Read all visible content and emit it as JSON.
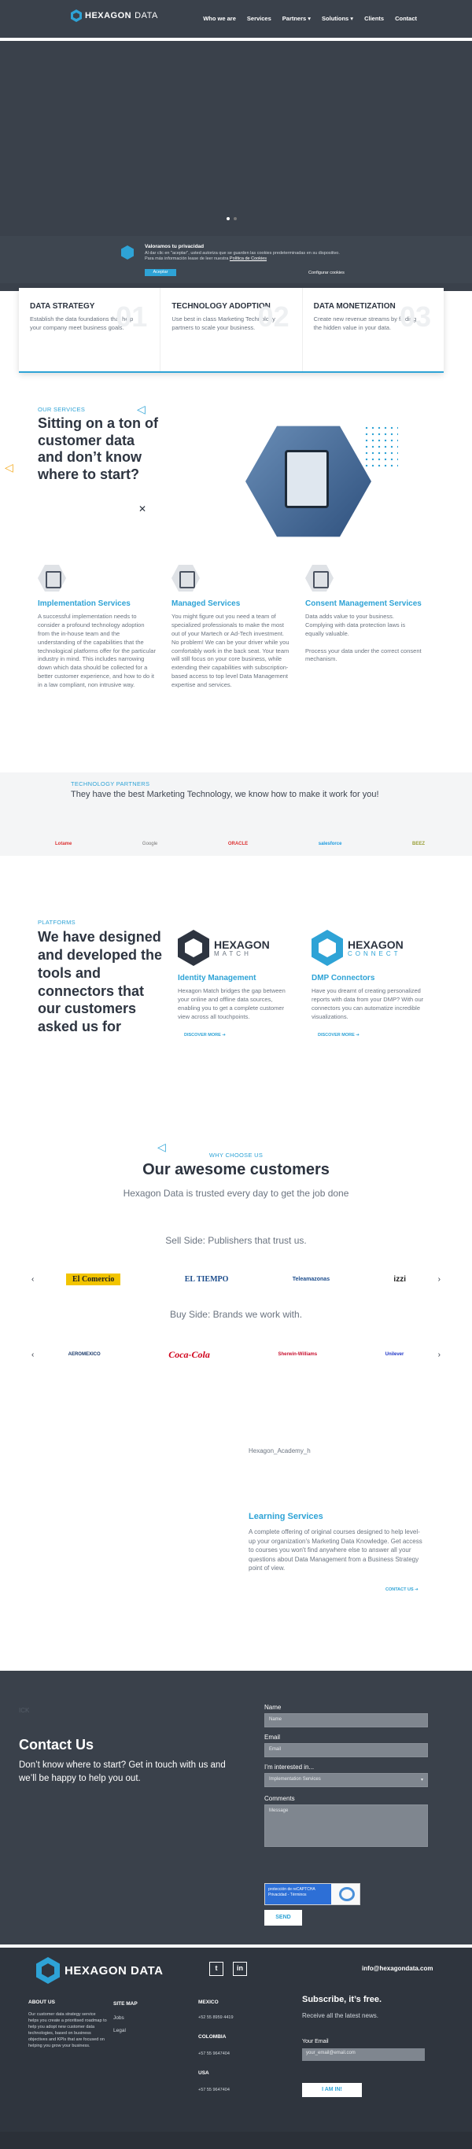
{
  "header": {
    "logo_text": "HEXAGON",
    "logo_text_2": "DATA",
    "nav": [
      "Who we are",
      "Services",
      "Partners ▾",
      "Solutions ▾",
      "Clients",
      "Contact"
    ]
  },
  "cookie": {
    "title": "Valoramos tu privacidad",
    "text": "Al dar clic en \"aceptar\", usted autoriza que se guarden las cookies predeterminadas en su dispositivo. Para más información lease de leer nuestra",
    "link": "Política de Cookies",
    "accept": "Aceptar",
    "config": "Configurar cookies"
  },
  "cards": [
    {
      "title": "DATA STRATEGY",
      "text": "Establish the data foundations that help your company meet business goals.",
      "num": "01"
    },
    {
      "title": "TECHNOLOGY ADOPTION",
      "text": "Use best in class Marketing Technology partners to scale your business.",
      "num": "02"
    },
    {
      "title": "DATA MONETIZATION",
      "text": "Create new revenue streams by finding the hidden value in your data.",
      "num": "03"
    }
  ],
  "services": {
    "eyebrow": "OUR SERVICES",
    "title": "Sitting on a ton of customer data and don’t know where to start?",
    "items": [
      {
        "title": "Implementation Services",
        "text": "A successful implementation needs to consider a profound technology adoption from the in-house team and the understanding of the capabilities that the technological platforms offer for the particular industry in mind. This includes narrowing down which data should be collected for a better customer experience, and how to do it in a law compliant, non intrusive way."
      },
      {
        "title": "Managed Services",
        "text": "You might figure out you need a team of specialized professionals to make the most out of your Martech or Ad-Tech investment. No problem!  We can be your driver while you comfortably work in the back seat. Your team will still focus on your core business, while extending their capabilities with subscription-based access to top level Data Management expertise and services."
      },
      {
        "title": "Consent Management Services",
        "text": "Data adds value to your business. Complying with data protection laws is equally valuable.\n\nProcess your data under the correct consent mechanism."
      }
    ]
  },
  "partners": {
    "eyebrow": "TECHNOLOGY PARTNERS",
    "title": "They have the best Marketing Technology, we know how to make it work for you!",
    "logos": [
      "Lotame",
      "Google",
      "ORACLE",
      "salesforce",
      "BEEZ"
    ]
  },
  "platforms": {
    "eyebrow": "PLATFORMS",
    "title": "We have designed and developed the tools and connectors that our customers asked us for",
    "items": [
      {
        "name": "HEXAGON",
        "sub": "MATCH",
        "title": "Identity Management",
        "text": "Hexagon Match bridges the gap between your online and offline data sources, enabling you to get a complete customer view across all touchpoints.",
        "more": "DISCOVER MORE  ➔"
      },
      {
        "name": "HEXAGON",
        "sub": "CONNECT",
        "title": "DMP Connectors",
        "text": "Have you dreamt of creating personalized reports with data from your DMP? With our connectors you can automatize incredible visualizations.",
        "more": "DISCOVER MORE  ➔"
      }
    ]
  },
  "why": {
    "eyebrow": "WHY CHOOSE US",
    "title": "Our awesome customers",
    "subtitle": "Hexagon Data is trusted every day to get the job done",
    "sell_title": "Sell Side: Publishers that trust us.",
    "sell_logos": [
      "El Comercio",
      "EL TIEMPO",
      "Teleamazonas",
      "izzi"
    ],
    "buy_title": "Buy Side: Brands we work with.",
    "buy_logos": [
      "AEROMEXICO",
      "Coca-Cola",
      "Sherwin-Williams",
      "Unilever"
    ]
  },
  "academy": {
    "img_alt": "Hexagon_Academy_h",
    "title": "Learning Services",
    "text": "A complete offering of original courses designed to help level-up your organization's Marketing Data Knowledge. Get access to courses you won't find anywhere else to answer all your questions about Data Management from a Business Strategy point of view.",
    "more": "CONTACT US  ➔"
  },
  "contact": {
    "ghost": "ICK",
    "title": "Contact Us",
    "subtitle": "Don’t know where to start? Get in touch with us and we’ll be happy to help you out.",
    "name_label": "Name",
    "name_placeholder": "Name",
    "email_label": "Email",
    "email_placeholder": "Email",
    "interest_label": "I’m interested in...",
    "interest_value": "Implementation Services",
    "comments_label": "Comments",
    "comments_placeholder": "Message",
    "captcha_text": "protección de reCAPTCHA\nPrivacidad - Términos",
    "send": "SEND"
  },
  "footer": {
    "logo_text": "HEXAGON DATA",
    "email": "info@hexagondata.com",
    "about_title": "ABOUT US",
    "about_text": "Our customer data strategy service helps you create a prioritised roadmap to help you adopt new customer data technologies, based on business objectives and KPIs that are focused on helping you grow your business.",
    "sitemap_title": "SITE MAP",
    "sitemap": [
      "Jobs",
      "Legal"
    ],
    "offices": [
      {
        "country": "MEXICO",
        "phone": "+52 55 8959 4419"
      },
      {
        "country": "COLOMBIA",
        "phone": "+57 55 9647404"
      },
      {
        "country": "USA",
        "phone": "+57 55 9647404"
      }
    ],
    "subscribe_title": "Subscribe, it’s free.",
    "subscribe_text": "Receive all the latest news.",
    "email_label": "Your Email",
    "email_placeholder": "your_email@email.com",
    "subscribe_button": "I AM IN!"
  }
}
